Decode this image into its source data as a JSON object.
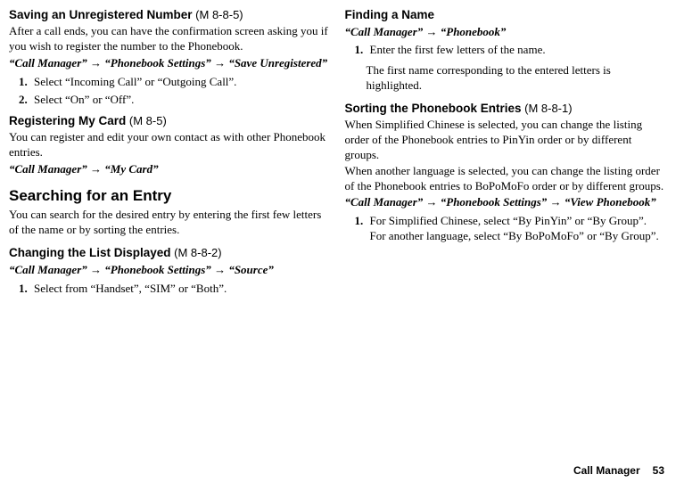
{
  "left": {
    "s1": {
      "title": "Saving an Unregistered Number",
      "code": " (M 8-8-5)",
      "p1": "After a call ends, you can have the confirmation screen asking you if you wish to register the number to the Phonebook.",
      "nav1": "“Call Manager”",
      "nav2": "“Phonebook Settings”",
      "nav3": "“Save Unregistered”",
      "li1": "Select “Incoming Call” or “Outgoing Call”.",
      "li2": "Select “On” or “Off”."
    },
    "s2": {
      "title": "Registering My Card",
      "code": " (M 8-5)",
      "p1": "You can register and edit your own contact as with other Phonebook entries.",
      "nav1": "“Call Manager”",
      "nav2": "“My Card”"
    },
    "s3": {
      "title": "Searching for an Entry",
      "p1": "You can search for the desired entry by entering the first few letters of the name or by sorting the entries."
    },
    "s4": {
      "title": "Changing the List Displayed",
      "code": " (M 8-8-2)",
      "nav1": "“Call Manager”",
      "nav2": "“Phonebook Settings”",
      "nav3": "“Source”",
      "li1": "Select from “Handset”, “SIM” or “Both”."
    }
  },
  "right": {
    "s1": {
      "title": "Finding a Name",
      "nav1": "“Call Manager”",
      "nav2": "“Phonebook”",
      "li1": "Enter the first few letters of the name.",
      "p1": "The first name corresponding to the entered letters is highlighted."
    },
    "s2": {
      "title": "Sorting the Phonebook Entries",
      "code": " (M 8-8-1)",
      "p1": "When Simplified Chinese is selected, you can change the listing order of the Phonebook entries to PinYin order or by different groups.",
      "p2": "When another language is selected, you can change the listing order of the Phonebook entries to BoPoMoFo order or by different groups.",
      "nav1": "“Call Manager”",
      "nav2": "“Phonebook Settings”",
      "nav3": "“View Phonebook”",
      "li1": "For Simplified Chinese, select “By PinYin” or “By Group”. For another language, select “By BoPoMoFo” or “By Group”."
    }
  },
  "footer": {
    "section": "Call Manager",
    "page": "53"
  },
  "arrow": "→"
}
